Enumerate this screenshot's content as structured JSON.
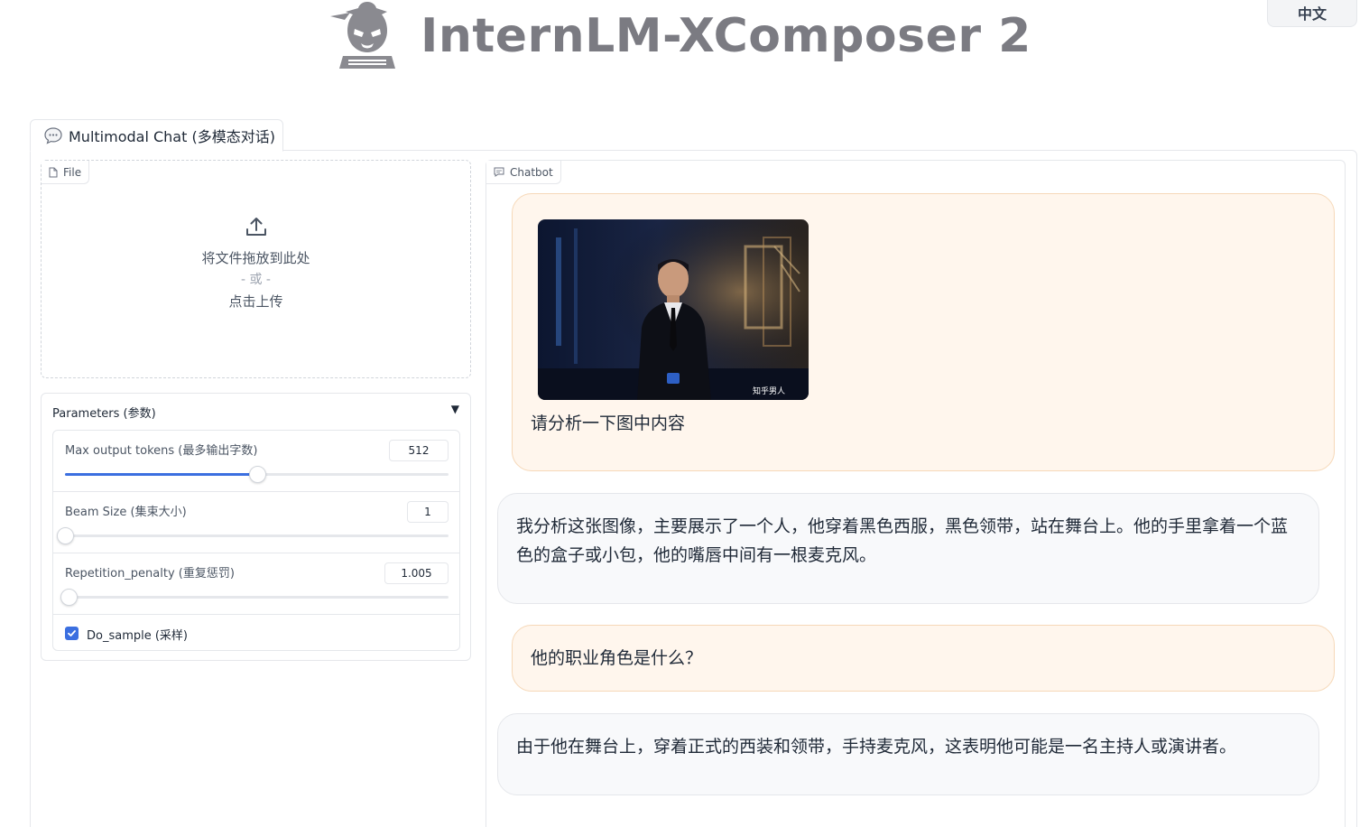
{
  "header": {
    "brand": "InternLM-XComposer 2",
    "language_button": "中文"
  },
  "tabs": [
    {
      "label": "Multimodal Chat (多模态对话)",
      "icon": "speech-bubble-icon"
    }
  ],
  "file_block": {
    "label": "File",
    "drop_text": "将文件拖放到此处",
    "or_text": "- 或 -",
    "click_text": "点击上传"
  },
  "parameters": {
    "title": "Parameters (参数)",
    "caret": "▼",
    "max_tokens": {
      "label": "Max output tokens (最多输出字数)",
      "value": "512",
      "fraction": 0.5
    },
    "beam_size": {
      "label": "Beam Size (集束大小)",
      "value": "1",
      "fraction": 0.0
    },
    "repetition": {
      "label": "Repetition_penalty (重复惩罚)",
      "value": "1.005",
      "fraction": 0.01
    },
    "do_sample": {
      "label": "Do_sample (采样)",
      "checked": true
    }
  },
  "chatbot": {
    "label": "Chatbot",
    "messages": [
      {
        "role": "user",
        "text": "请分析一下图中内容",
        "image_watermark": "知乎男人"
      },
      {
        "role": "bot",
        "text": "我分析这张图像，主要展示了一个人，他穿着黑色西服，黑色领带，站在舞台上。他的手里拿着一个蓝色的盒子或小包，他的嘴唇中间有一根麦克风。"
      },
      {
        "role": "user",
        "text": "他的职业角色是什么？"
      },
      {
        "role": "bot",
        "text": "由于他在舞台上，穿着正式的西装和领带，手持麦克风，这表明他可能是一名主持人或演讲者。"
      }
    ]
  },
  "colors": {
    "accent": "#3b6fe0",
    "user_bubble": "#fff6ed",
    "bot_bubble": "#f8f9fb",
    "brand_text": "#7b7b82"
  }
}
